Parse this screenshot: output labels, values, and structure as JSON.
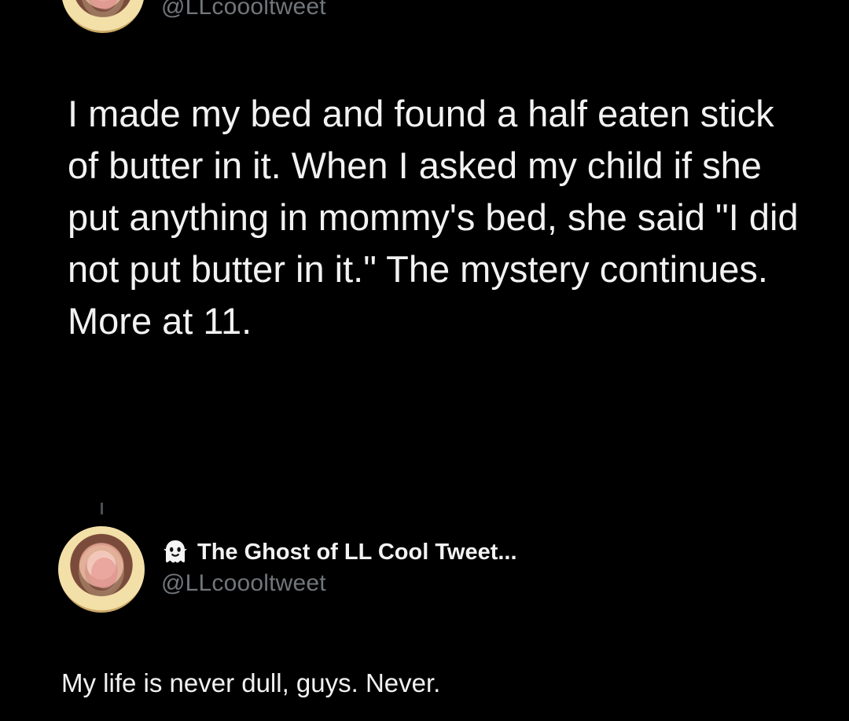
{
  "top_post": {
    "handle": "@LLcoooltweet",
    "text": "I made my bed and found a half eaten stick of butter in it. When I asked my child if she put anything in mommy's bed, she said \"I did not put butter in it.\" The mystery continues. More at 11."
  },
  "reply_post": {
    "display_name": "The Ghost of LL Cool Tweet...",
    "handle": "@LLcoooltweet",
    "text": "My life is never dull, guys. Never.",
    "profile_icon": "ghost-emoji-icon"
  },
  "colors": {
    "background": "#000000",
    "primary_text": "#f2f2f2",
    "secondary_text": "#71767b",
    "thread_line": "#4b4f54"
  }
}
